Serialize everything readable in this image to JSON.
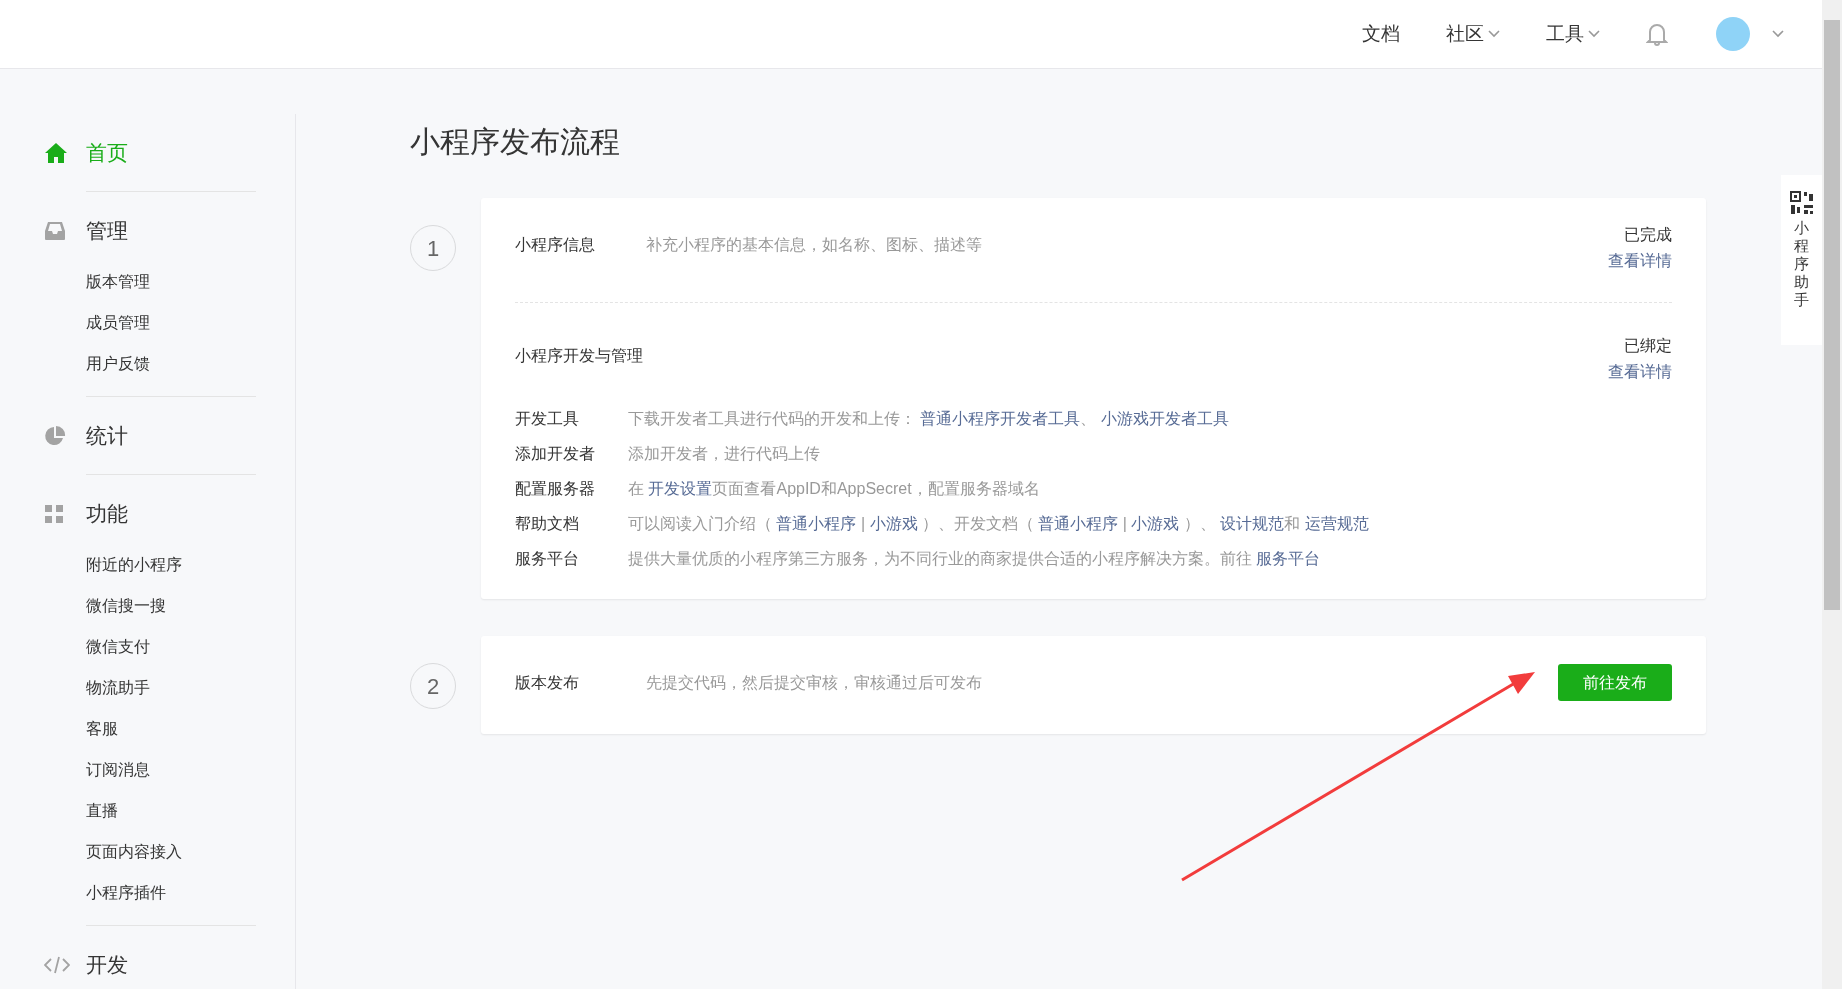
{
  "top_nav": [
    {
      "label": "文档",
      "kind": "link"
    },
    {
      "label": "社区",
      "kind": "dropdown"
    },
    {
      "label": "工具",
      "kind": "dropdown"
    }
  ],
  "sidebar": {
    "sections": [
      {
        "label": "首页",
        "kind": "home",
        "selected": true
      },
      {
        "label": "管理",
        "kind": "inbox",
        "selected": false,
        "items": [
          {
            "label": "版本管理"
          },
          {
            "label": "成员管理"
          },
          {
            "label": "用户反馈"
          }
        ]
      },
      {
        "label": "统计",
        "kind": "pie",
        "selected": false
      },
      {
        "label": "功能",
        "kind": "grid",
        "selected": false,
        "items": [
          {
            "label": "附近的小程序"
          },
          {
            "label": "微信搜一搜"
          },
          {
            "label": "微信支付"
          },
          {
            "label": "物流助手"
          },
          {
            "label": "客服"
          },
          {
            "label": "订阅消息"
          },
          {
            "label": "直播"
          },
          {
            "label": "页面内容接入"
          },
          {
            "label": "小程序插件"
          }
        ]
      },
      {
        "label": "开发",
        "kind": "code",
        "selected": false
      }
    ]
  },
  "page_title": "小程序发布流程",
  "steps": [
    {
      "number": "1",
      "sections": [
        {
          "title": "小程序信息",
          "description": "补充小程序的基本信息，如名称、图标、描述等",
          "status": "已完成",
          "details_link": "查看详情"
        },
        {
          "title": "小程序开发与管理",
          "status": "已绑定",
          "details_link": "查看详情",
          "rows": [
            {
              "label": "开发工具",
              "parts": [
                {
                  "kind": "text",
                  "text": "下载开发者工具进行代码的开发和上传： "
                },
                {
                  "kind": "link",
                  "text": "普通小程序开发者工具"
                },
                {
                  "kind": "text",
                  "text": "、 "
                },
                {
                  "kind": "link",
                  "text": "小游戏开发者工具"
                }
              ]
            },
            {
              "label": "添加开发者",
              "parts": [
                {
                  "kind": "text",
                  "text": "添加开发者，进行代码上传"
                }
              ]
            },
            {
              "label": "配置服务器",
              "parts": [
                {
                  "kind": "text",
                  "text": "在 "
                },
                {
                  "kind": "link",
                  "text": "开发设置"
                },
                {
                  "kind": "text",
                  "text": "页面查看AppID和AppSecret，配置服务器域名"
                }
              ]
            },
            {
              "label": "帮助文档",
              "parts": [
                {
                  "kind": "text",
                  "text": "可以阅读入门介绍（ "
                },
                {
                  "kind": "link",
                  "text": "普通小程序"
                },
                {
                  "kind": "text",
                  "text": " | "
                },
                {
                  "kind": "link",
                  "text": "小游戏"
                },
                {
                  "kind": "text",
                  "text": " ）、开发文档（ "
                },
                {
                  "kind": "link",
                  "text": "普通小程序"
                },
                {
                  "kind": "text",
                  "text": " | "
                },
                {
                  "kind": "link",
                  "text": "小游戏"
                },
                {
                  "kind": "text",
                  "text": " ）、 "
                },
                {
                  "kind": "link",
                  "text": "设计规范"
                },
                {
                  "kind": "text",
                  "text": "和 "
                },
                {
                  "kind": "link",
                  "text": "运营规范"
                }
              ]
            },
            {
              "label": "服务平台",
              "parts": [
                {
                  "kind": "text",
                  "text": "提供大量优质的小程序第三方服务，为不同行业的商家提供合适的小程序解决方案。前往 "
                },
                {
                  "kind": "link",
                  "text": "服务平台"
                }
              ]
            }
          ]
        }
      ]
    },
    {
      "number": "2",
      "sections": [
        {
          "title": "版本发布",
          "description": "先提交代码，然后提交审核，审核通过后可发布",
          "button": "前往发布"
        }
      ]
    }
  ],
  "helper": {
    "label": "小程序助手"
  }
}
